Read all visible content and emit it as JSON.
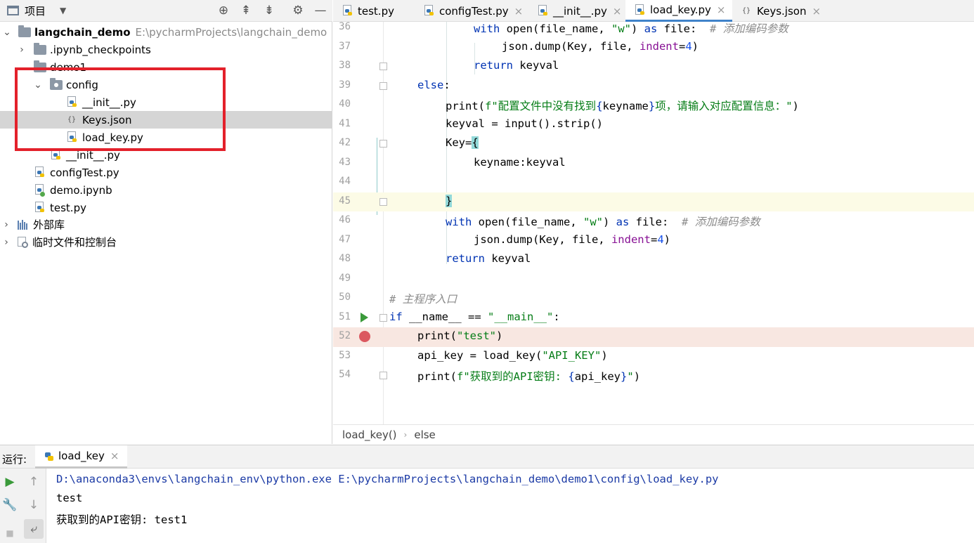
{
  "project": {
    "header_label": "项目",
    "tree": [
      {
        "label": "langchain_demo",
        "path": "E:\\pycharmProjects\\langchain_demo"
      },
      {
        "label": ".ipynb_checkpoints"
      },
      {
        "label": "demo1"
      },
      {
        "label": "config"
      },
      {
        "label": "__init__.py"
      },
      {
        "label": "Keys.json"
      },
      {
        "label": "load_key.py"
      },
      {
        "label": "__init__.py"
      },
      {
        "label": "configTest.py"
      },
      {
        "label": "demo.ipynb"
      },
      {
        "label": "test.py"
      },
      {
        "label": "外部库"
      },
      {
        "label": "临时文件和控制台"
      }
    ]
  },
  "tabs": [
    {
      "label": "test.py"
    },
    {
      "label": "configTest.py"
    },
    {
      "label": "__init__.py"
    },
    {
      "label": "load_key.py",
      "active": true
    },
    {
      "label": "Keys.json"
    }
  ],
  "editor": {
    "lines": [
      {
        "num": "36"
      },
      {
        "num": "37"
      },
      {
        "num": "38"
      },
      {
        "num": "39"
      },
      {
        "num": "40"
      },
      {
        "num": "41"
      },
      {
        "num": "42"
      },
      {
        "num": "43"
      },
      {
        "num": "44"
      },
      {
        "num": "45"
      },
      {
        "num": "46"
      },
      {
        "num": "47"
      },
      {
        "num": "48"
      },
      {
        "num": "49"
      },
      {
        "num": "50"
      },
      {
        "num": "51"
      },
      {
        "num": "52"
      },
      {
        "num": "53"
      },
      {
        "num": "54"
      }
    ],
    "code": {
      "l36": {
        "kw1": "with ",
        "fn": "open",
        "a": "(file_name, ",
        "s": "\"w\"",
        "b": ") ",
        "kw2": "as",
        "c": " file:  ",
        "cmt": "# 添加编码参数"
      },
      "l37": {
        "a": "json.dump(Key, file, ",
        "p": "indent",
        "b": "=",
        "n": "4",
        "c": ")"
      },
      "l38": {
        "kw": "return",
        "a": " keyval"
      },
      "l39": {
        "kw": "else",
        "a": ":"
      },
      "l40": {
        "fn": "print",
        "a": "(",
        "s1": "f\"配置文件中没有找到",
        "b1": "{",
        "v": "keyname",
        "b2": "}",
        "s2": "项，请输入对应配置信息：\"",
        "c": ")"
      },
      "l41": {
        "a": "keyval = ",
        "fn": "input",
        "b": "().strip()"
      },
      "l42": {
        "a": "Key=",
        "br": "{"
      },
      "l43": {
        "a": "keyname:keyval"
      },
      "l45": {
        "br": "}"
      },
      "l46": {
        "kw1": "with ",
        "fn": "open",
        "a": "(file_name, ",
        "s": "\"w\"",
        "b": ") ",
        "kw2": "as",
        "c": " file:  ",
        "cmt": "# 添加编码参数"
      },
      "l47": {
        "a": "json.dump(Key, file, ",
        "p": "indent",
        "b": "=",
        "n": "4",
        "c": ")"
      },
      "l48": {
        "kw": "return",
        "a": " keyval"
      },
      "l50": {
        "cmt": "# 主程序入口"
      },
      "l51": {
        "kw": "if",
        "a": " __name__ == ",
        "s": "\"__main__\"",
        "b": ":"
      },
      "l52": {
        "fn": "print",
        "a": "(",
        "s": "\"test\"",
        "b": ")"
      },
      "l53": {
        "a": "api_key = load_key(",
        "s": "\"API_KEY\"",
        "b": ")"
      },
      "l54": {
        "fn": "print",
        "a": "(",
        "s1": "f\"获取到的API密钥: ",
        "b1": "{",
        "v": "api_key",
        "b2": "}",
        "s2": "\"",
        "c": ")"
      }
    }
  },
  "breadcrumb": {
    "item1": "load_key()",
    "item2": "else"
  },
  "run": {
    "label": "运行:",
    "tab": "load_key",
    "output": [
      "D:\\anaconda3\\envs\\langchain_env\\python.exe E:\\pycharmProjects\\langchain_demo\\demo1\\config\\load_key.py",
      "test",
      "获取到的API密钥: test1"
    ]
  },
  "colors": {
    "highlight_box": "#e3212b",
    "active_tab_underline": "#4083c9",
    "breakpoint": "#db5860"
  }
}
